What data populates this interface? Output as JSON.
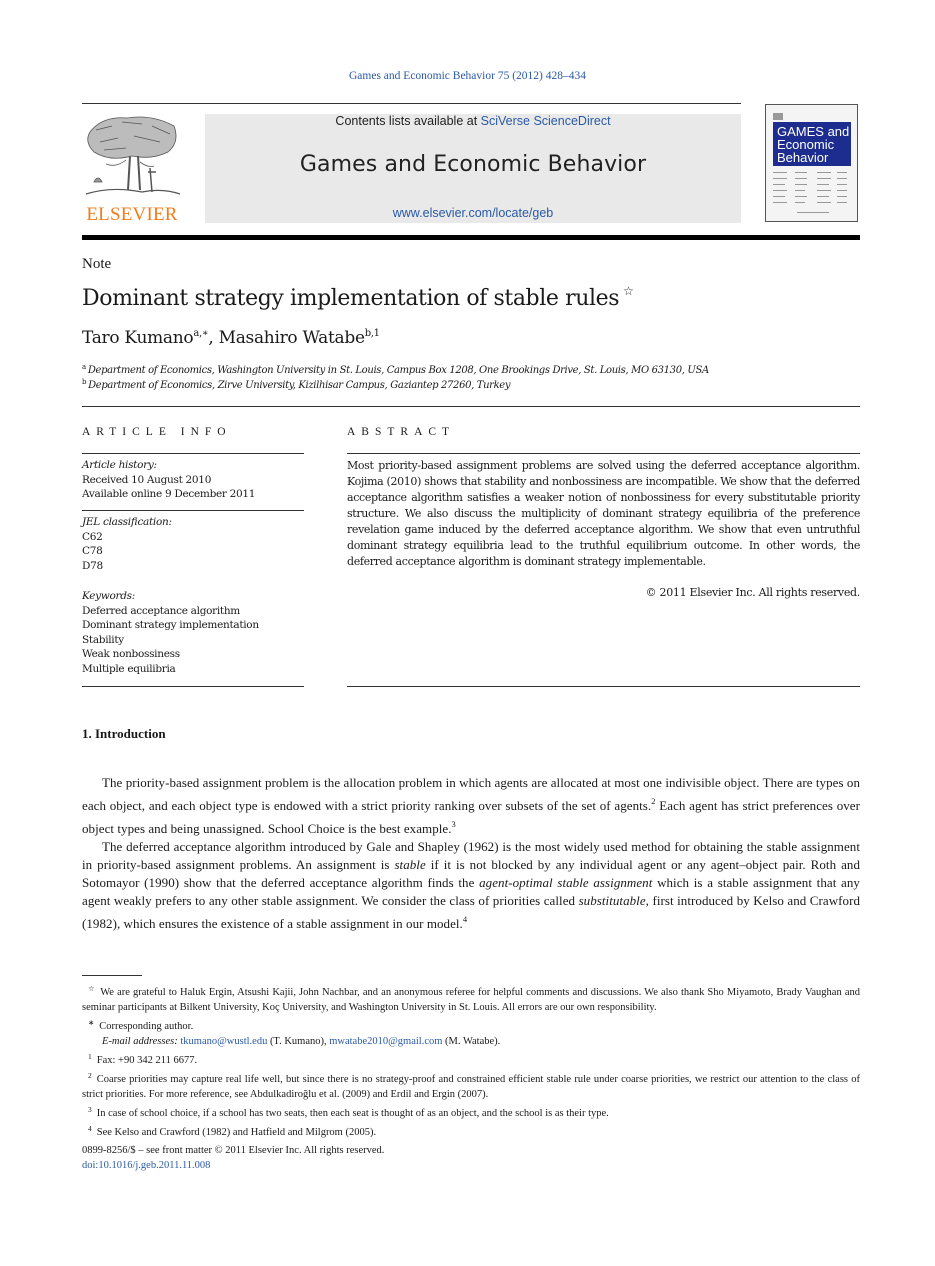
{
  "header": {
    "journal_reference": "Games and Economic Behavior 75 (2012) 428–434",
    "contents_prefix": "Contents lists available at ",
    "contents_link": "SciVerse ScienceDirect",
    "journal_title": "Games and Economic Behavior",
    "journal_url": "www.elsevier.com/locate/geb",
    "publisher_logo_text": "ELSEVIER",
    "cover_title_lines": [
      "GAMES and",
      "Economic",
      "Behavior"
    ],
    "colors": {
      "link": "#2a5aa6",
      "publisher_orange": "#f07d1c",
      "cover_blue": "#1d2d8f",
      "banner_bg": "#e9e9e9"
    }
  },
  "article": {
    "type": "Note",
    "title": "Dominant strategy implementation of stable rules",
    "title_mark": "☆",
    "authors": [
      {
        "name": "Taro Kumano",
        "marks": "a,∗"
      },
      {
        "name": "Masahiro Watabe",
        "marks": "b,1"
      }
    ],
    "author_separator": ", ",
    "affiliations": [
      {
        "mark": "a",
        "text": "Department of Economics, Washington University in St. Louis, Campus Box 1208, One Brookings Drive, St. Louis, MO 63130, USA"
      },
      {
        "mark": "b",
        "text": "Department of Economics, Zirve University, Kizilhisar Campus, Gaziantep 27260, Turkey"
      }
    ]
  },
  "article_info": {
    "heading": "ARTICLE INFO",
    "history_label": "Article history:",
    "history": [
      "Received 10 August 2010",
      "Available online 9 December 2011"
    ],
    "jel_label": "JEL classification:",
    "jel": [
      "C62",
      "C78",
      "D78"
    ],
    "keywords_label": "Keywords:",
    "keywords": [
      "Deferred acceptance algorithm",
      "Dominant strategy implementation",
      "Stability",
      "Weak nonbossiness",
      "Multiple equilibria"
    ]
  },
  "abstract": {
    "heading": "ABSTRACT",
    "text": "Most priority-based assignment problems are solved using the deferred acceptance algorithm. Kojima (2010) shows that stability and nonbossiness are incompatible. We show that the deferred acceptance algorithm satisfies a weaker notion of nonbossiness for every substitutable priority structure. We also discuss the multiplicity of dominant strategy equilibria of the preference revelation game induced by the deferred acceptance algorithm. We show that even untruthful dominant strategy equilibria lead to the truthful equilibrium outcome. In other words, the deferred acceptance algorithm is dominant strategy implementable.",
    "copyright": "© 2011 Elsevier Inc. All rights reserved."
  },
  "introduction": {
    "heading": "1. Introduction",
    "p1": {
      "a": "The priority-based assignment problem is the allocation problem in which agents are allocated at most one indivisible object. There are types on each object, and each object type is endowed with a strict priority ranking over subsets of the set of agents.",
      "fn_a": "2",
      "b": " Each agent has strict preferences over object types and being unassigned. School Choice is the best example.",
      "fn_b": "3"
    },
    "p2": {
      "a": "The deferred acceptance algorithm introduced by Gale and Shapley (1962) is the most widely used method for obtaining the stable assignment in priority-based assignment problems. An assignment is ",
      "em1": "stable",
      "b": " if it is not blocked by any individual agent or any agent–object pair. Roth and Sotomayor (1990) show that the deferred acceptance algorithm finds the ",
      "em2": "agent-optimal stable assignment",
      "c": " which is a stable assignment that any agent weakly prefers to any other stable assignment. We consider the class of priorities called ",
      "em3": "substitutable",
      "d": ", first introduced by Kelso and Crawford (1982), which ensures the existence of a stable assignment in our model.",
      "fn": "4"
    }
  },
  "footnotes": {
    "star": {
      "mark": "☆",
      "text": "We are grateful to Haluk Ergin, Atsushi Kajii, John Nachbar, and an anonymous referee for helpful comments and discussions. We also thank Sho Miyamoto, Brady Vaughan and seminar participants at Bilkent University, Koç University, and Washington University in St. Louis. All errors are our own responsibility."
    },
    "corresponding": {
      "mark": "∗",
      "text": "Corresponding author."
    },
    "emails": {
      "label": "E-mail addresses:",
      "email1": "tkumano@wustl.edu",
      "name1": " (T. Kumano), ",
      "email2": "mwatabe2010@gmail.com",
      "name2": " (M. Watabe)."
    },
    "notes": [
      {
        "mark": "1",
        "text": "Fax: +90 342 211 6677."
      },
      {
        "mark": "2",
        "text": "Coarse priorities may capture real life well, but since there is no strategy-proof and constrained efficient stable rule under coarse priorities, we restrict our attention to the class of strict priorities. For more reference, see Abdulkadiroğlu et al. (2009) and Erdil and Ergin (2007)."
      },
      {
        "mark": "3",
        "text": "In case of school choice, if a school has two seats, then each seat is thought of as an object, and the school is as their type."
      },
      {
        "mark": "4",
        "text": "See Kelso and Crawford (1982) and Hatfield and Milgrom (2005)."
      }
    ]
  },
  "footer": {
    "issn_line": "0899-8256/$ – see front matter  © 2011 Elsevier Inc. All rights reserved.",
    "doi": "doi:10.1016/j.geb.2011.11.008"
  }
}
